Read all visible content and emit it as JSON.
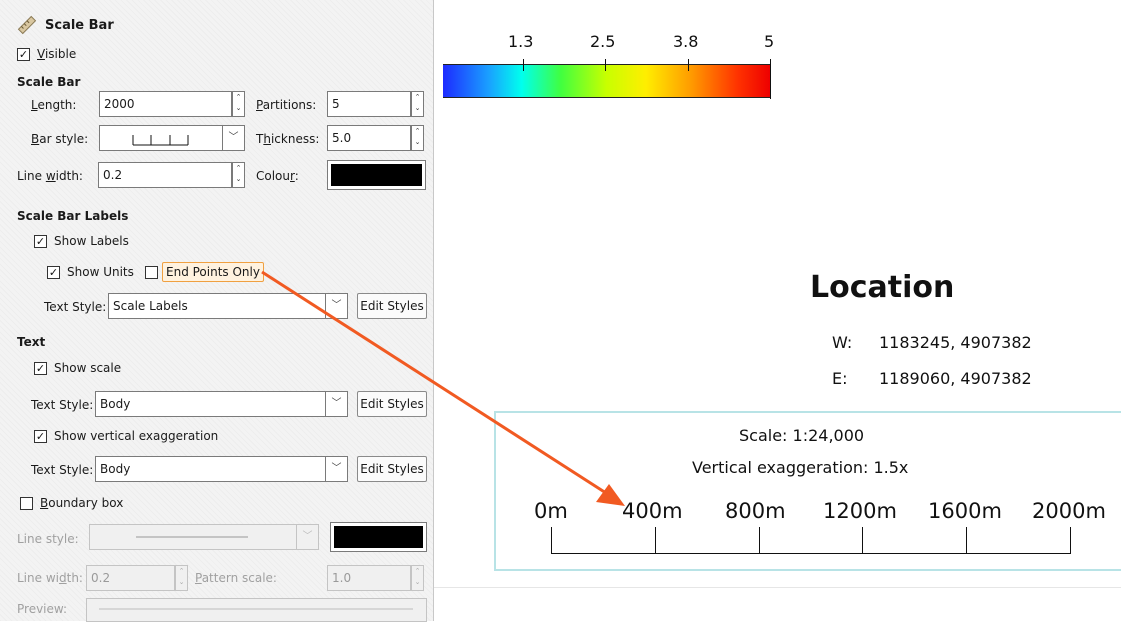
{
  "panel": {
    "title": "Scale Bar",
    "visible_label": "Visible",
    "visible_checked": true,
    "scale_bar_section": "Scale Bar",
    "length_label": "Length:",
    "length_value": "2000",
    "partitions_label": "Partitions:",
    "partitions_value": "5",
    "bar_style_label": "Bar style:",
    "thickness_label": "Thickness:",
    "thickness_value": "5.0",
    "line_width_label": "Line width:",
    "line_width_value": "0.2",
    "colour_label": "Colour:",
    "colour_value": "#000000",
    "labels_section": "Scale Bar Labels",
    "show_labels": "Show Labels",
    "show_labels_checked": true,
    "show_units": "Show Units",
    "show_units_checked": true,
    "end_points_only": "End Points Only",
    "end_points_only_checked": false,
    "labels_text_style_label": "Text Style:",
    "labels_text_style_value": "Scale Labels",
    "edit_styles": "Edit Styles",
    "text_section": "Text",
    "show_scale": "Show scale",
    "show_scale_checked": true,
    "scale_text_style_label": "Text Style:",
    "scale_text_style_value": "Body",
    "show_vert_exag": "Show vertical exaggeration",
    "show_vert_exag_checked": true,
    "vert_text_style_label": "Text Style:",
    "vert_text_style_value": "Body",
    "boundary_box": "Boundary box",
    "boundary_box_checked": false,
    "line_style_label": "Line style:",
    "bb_line_width_label": "Line width:",
    "bb_line_width_value": "0.2",
    "pattern_scale_label": "Pattern scale:",
    "pattern_scale_value": "1.0",
    "preview_label": "Preview:"
  },
  "view": {
    "color_legend_ticks": [
      "1.3",
      "2.5",
      "3.8",
      "5"
    ],
    "location_title": "Location",
    "coords": [
      {
        "label": "W:",
        "value": "1183245, 4907382"
      },
      {
        "label": "E:",
        "value": "1189060, 4907382"
      }
    ],
    "scale_text": "Scale: 1:24,000",
    "vert_exag_text": "Vertical exaggeration: 1.5x",
    "scale_labels": [
      "0m",
      "400m",
      "800m",
      "1200m",
      "1600m",
      "2000m"
    ]
  },
  "colors": {
    "annotation_arrow": "#f15a22",
    "highlight_border": "#f0a040",
    "boundary_box": "#b8e3e6"
  }
}
